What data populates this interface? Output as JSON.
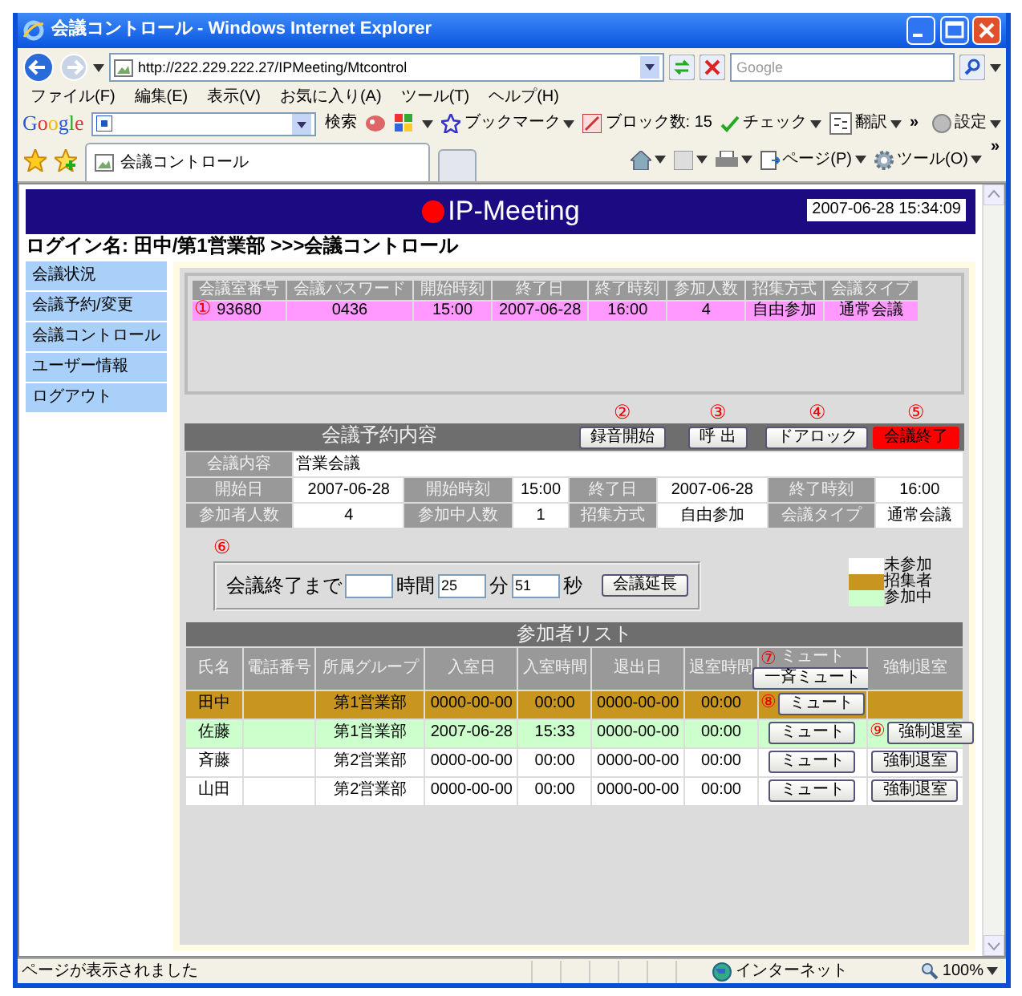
{
  "browser": {
    "title": "会議コントロール - Windows Internet Explorer",
    "address": "http://222.229.222.27/IPMeeting/Mtcontrol",
    "search_placeholder": "Google",
    "menu": [
      "ファイル(F)",
      "編集(E)",
      "表示(V)",
      "お気に入り(A)",
      "ツール(T)",
      "ヘルプ(H)"
    ],
    "google_bar": {
      "logo": "Google",
      "search_button": "検索",
      "items": [
        {
          "label": "ブックマーク",
          "dropdown": true
        },
        {
          "label": "ブロック数: 15",
          "dropdown": false
        },
        {
          "label": "チェック",
          "dropdown": true
        },
        {
          "label": "翻訳",
          "dropdown": true
        }
      ],
      "more": "»",
      "settings": "設定"
    },
    "tab": "会議コントロール",
    "command_bar": {
      "items": [
        {
          "label": "ページ(P)",
          "dropdown": true
        },
        {
          "label": "ツール(O)",
          "dropdown": true
        }
      ],
      "more": "»"
    }
  },
  "header": {
    "logo": "IP-Meeting",
    "datetime": "2007-06-28 15:34:09"
  },
  "breadcrumb": "ログイン名: 田中/第1営業部 >>>会議コントロール",
  "sidebar": [
    "会議状況",
    "会議予約/変更",
    "会議コントロール",
    "ユーザー情報",
    "ログアウト"
  ],
  "summary": {
    "marker": "①",
    "columns": [
      "会議室番号",
      "会議パスワード",
      "開始時刻",
      "終了日",
      "終了時刻",
      "参加人数",
      "招集方式",
      "会議タイプ"
    ],
    "row": [
      "93680",
      "0436",
      "15:00",
      "2007-06-28",
      "16:00",
      "4",
      "自由参加",
      "通常会議"
    ]
  },
  "actions": [
    {
      "marker": "②",
      "label": "録音開始",
      "kind": "normal"
    },
    {
      "marker": "③",
      "label": "呼 出",
      "kind": "normal"
    },
    {
      "marker": "④",
      "label": "ドアロック",
      "kind": "normal"
    },
    {
      "marker": "⑤",
      "label": "会議終了",
      "kind": "danger"
    }
  ],
  "reservation": {
    "title": "会議予約内容",
    "content_label": "会議内容",
    "content": "営業会議",
    "fields": [
      {
        "label": "開始日",
        "value": "2007-06-28"
      },
      {
        "label": "開始時刻",
        "value": "15:00"
      },
      {
        "label": "終了日",
        "value": "2007-06-28"
      },
      {
        "label": "終了時刻",
        "value": "16:00"
      },
      {
        "label": "参加者人数",
        "value": "4"
      },
      {
        "label": "参加中人数",
        "value": "1"
      },
      {
        "label": "招集方式",
        "value": "自由参加"
      },
      {
        "label": "会議タイプ",
        "value": "通常会議"
      }
    ]
  },
  "timer": {
    "marker": "⑥",
    "label": "会議終了まで",
    "minutes": "25",
    "seconds": "51",
    "units": [
      "時間",
      "分",
      "秒"
    ],
    "button": "会議延長"
  },
  "legend": [
    {
      "label": "未参加",
      "color": "#ffffff"
    },
    {
      "label": "招集者",
      "color": "#c8961e"
    },
    {
      "label": "参加中",
      "color": "#ccffcc"
    }
  ],
  "participants": {
    "title": "参加者リスト",
    "columns": [
      "氏名",
      "電話番号",
      "所属グループ",
      "入室日",
      "入室時間",
      "退出日",
      "退室時間",
      "ミュート",
      "強制退室"
    ],
    "mute_all": {
      "marker": "⑦",
      "label": "一斉ミュート"
    },
    "rows": [
      {
        "name": "田中",
        "group": "第1営業部",
        "entry_date": "0000-00-00",
        "entry_time": "00:00",
        "exit_date": "0000-00-00",
        "exit_time": "00:00",
        "color": "#c8961e",
        "mute": {
          "marker": "⑧",
          "label": "ミュート"
        }
      },
      {
        "name": "佐藤",
        "group": "第1営業部",
        "entry_date": "2007-06-28",
        "entry_time": "15:33",
        "exit_date": "0000-00-00",
        "exit_time": "00:00",
        "color": "#ccffcc",
        "mute": {
          "label": "ミュート"
        },
        "kick": {
          "marker": "⑨",
          "label": "強制退室"
        }
      },
      {
        "name": "斉藤",
        "group": "第2営業部",
        "entry_date": "0000-00-00",
        "entry_time": "00:00",
        "exit_date": "0000-00-00",
        "exit_time": "00:00",
        "color": "#ffffff",
        "mute": {
          "label": "ミュート"
        },
        "kick": {
          "label": "強制退室"
        }
      },
      {
        "name": "山田",
        "group": "第2営業部",
        "entry_date": "0000-00-00",
        "entry_time": "00:00",
        "exit_date": "0000-00-00",
        "exit_time": "00:00",
        "color": "#ffffff",
        "mute": {
          "label": "ミュート"
        },
        "kick": {
          "label": "強制退室"
        }
      }
    ]
  },
  "status_bar": {
    "text": "ページが表示されました",
    "zone": "インターネット",
    "zoom": "100%"
  }
}
